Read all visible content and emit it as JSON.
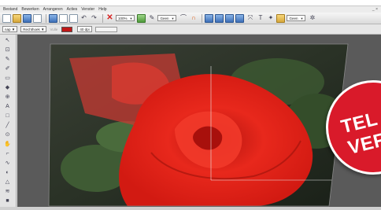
{
  "menubar": {
    "items": [
      "Bestand",
      "Bewerken",
      "Arrangeren",
      "Acties",
      "Venster",
      "Help"
    ],
    "window_controls": "_ ×"
  },
  "toolbar": {
    "zoom_value": "100%",
    "preset_1": "Geen",
    "preset_2": "Geen"
  },
  "options": {
    "mode_value": "nap",
    "shape_value": "Rechthoek",
    "fill_label": "Vulle",
    "size_value": "40 dpi",
    "accent_color": "#c01818"
  },
  "sticker": {
    "line1": "TEL",
    "line2": "VER",
    "color": "#d91a2a"
  },
  "icons": {
    "new": "new-file-icon",
    "open": "open-folder-icon",
    "save": "save-icon",
    "undo": "undo-icon",
    "redo": "redo-icon",
    "delete": "delete-icon"
  }
}
